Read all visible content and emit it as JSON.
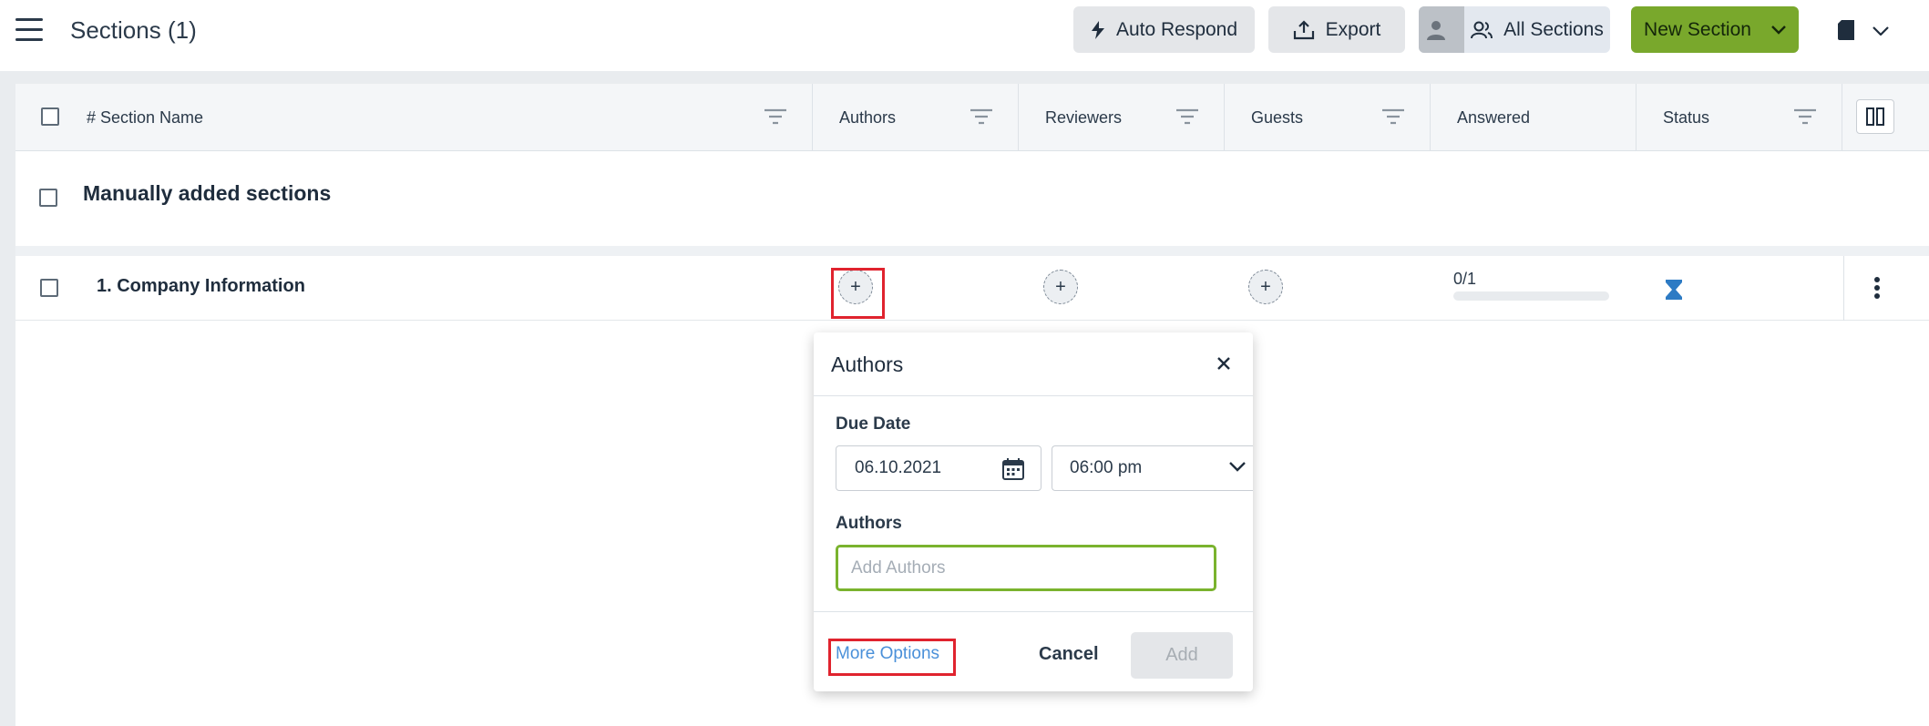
{
  "header": {
    "title": "Sections (1)",
    "auto_respond_label": "Auto Respond",
    "export_label": "Export",
    "all_sections_label": "All Sections",
    "new_section_label": "New Section"
  },
  "table": {
    "columns": [
      {
        "label": "# Section Name"
      },
      {
        "label": "Authors"
      },
      {
        "label": "Reviewers"
      },
      {
        "label": "Guests"
      },
      {
        "label": "Answered"
      },
      {
        "label": "Status"
      }
    ],
    "group": {
      "label": "Manually added sections"
    },
    "rows": [
      {
        "name": "1. Company Information",
        "answered": "0/1",
        "progress": 0,
        "status": "hourglass-icon"
      }
    ]
  },
  "popover": {
    "title": "Authors",
    "due_date_label": "Due Date",
    "date_value": "06.10.2021",
    "time_value": "06:00 pm",
    "authors_label": "Authors",
    "authors_placeholder": "Add Authors",
    "more_options_label": "More Options",
    "cancel_label": "Cancel",
    "add_label": "Add"
  },
  "colors": {
    "primary_green": "#79a82c",
    "link_blue": "#4a90d9",
    "highlight_red": "#e0232e",
    "status_blue": "#2d7bc4"
  }
}
